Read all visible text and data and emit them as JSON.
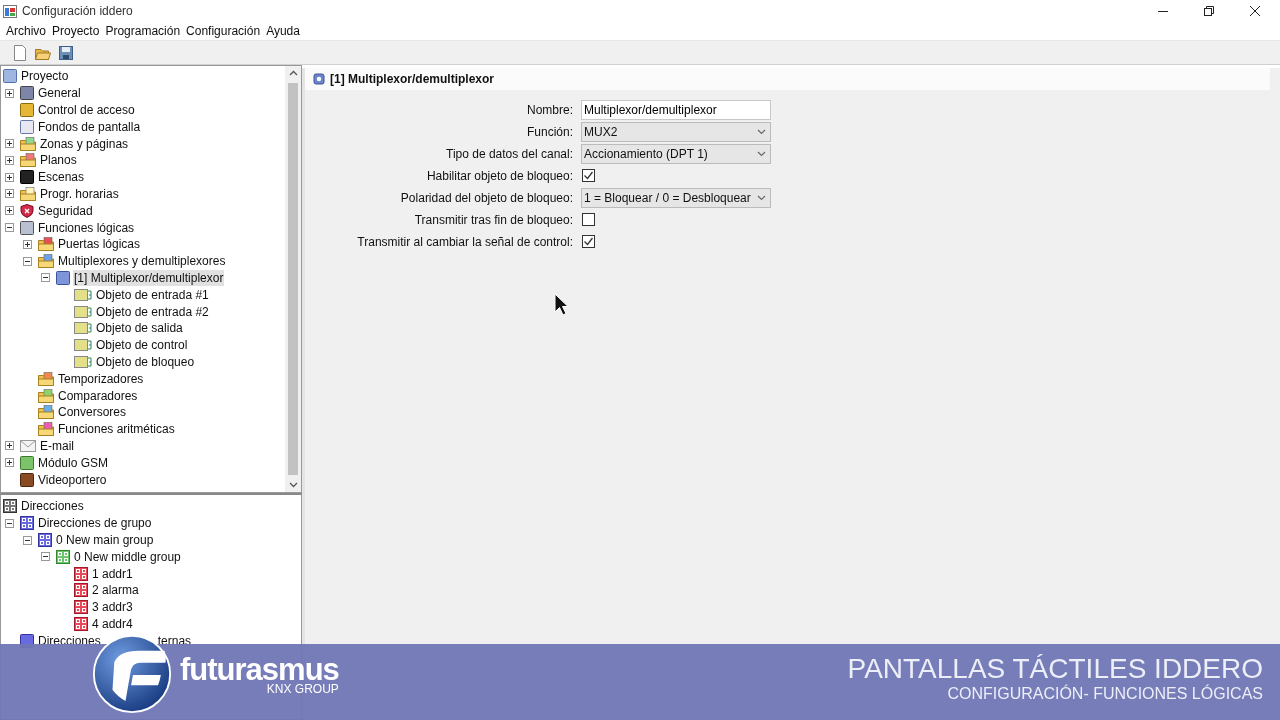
{
  "window": {
    "title": "Configuración iddero"
  },
  "menu": [
    "Archivo",
    "Proyecto",
    "Programación",
    "Configuración",
    "Ayuda"
  ],
  "project_tree": [
    {
      "label": "Proyecto",
      "selected": false,
      "children": [
        {
          "label": "General",
          "expanded": false,
          "selected": false
        },
        {
          "label": "Control de acceso",
          "selected": false
        },
        {
          "label": "Fondos de pantalla",
          "selected": false
        },
        {
          "label": "Zonas y páginas",
          "expanded": false,
          "selected": false
        },
        {
          "label": "Planos",
          "expanded": false,
          "selected": false
        },
        {
          "label": "Escenas",
          "expanded": false,
          "selected": false
        },
        {
          "label": "Progr. horarias",
          "expanded": false,
          "selected": false
        },
        {
          "label": "Seguridad",
          "expanded": false,
          "selected": false
        },
        {
          "label": "Funciones lógicas",
          "expanded": true,
          "selected": false,
          "children": [
            {
              "label": "Puertas lógicas",
              "expanded": false,
              "selected": false
            },
            {
              "label": "Multiplexores y demultiplexores",
              "expanded": true,
              "selected": false,
              "children": [
                {
                  "label": "[1] Multiplexor/demultiplexor",
                  "expanded": true,
                  "selected": true,
                  "children": [
                    {
                      "label": "Objeto de entrada #1",
                      "selected": false
                    },
                    {
                      "label": "Objeto de entrada #2",
                      "selected": false
                    },
                    {
                      "label": "Objeto de salida",
                      "selected": false
                    },
                    {
                      "label": "Objeto de control",
                      "selected": false
                    },
                    {
                      "label": "Objeto de bloqueo",
                      "selected": false
                    }
                  ]
                }
              ]
            },
            {
              "label": "Temporizadores",
              "selected": false
            },
            {
              "label": "Comparadores",
              "selected": false
            },
            {
              "label": "Conversores",
              "selected": false
            },
            {
              "label": "Funciones aritméticas",
              "selected": false
            }
          ]
        },
        {
          "label": "E-mail",
          "expanded": false,
          "selected": false
        },
        {
          "label": "Módulo GSM",
          "expanded": false,
          "selected": false
        },
        {
          "label": "Videoportero",
          "selected": false
        }
      ]
    }
  ],
  "address_tree": [
    {
      "label": "Direcciones",
      "selected": false,
      "children": [
        {
          "label": "Direcciones de grupo",
          "expanded": true,
          "selected": false,
          "children": [
            {
              "label": "0 New main group",
              "expanded": true,
              "selected": false,
              "children": [
                {
                  "label": "0 New middle group",
                  "expanded": true,
                  "selected": false,
                  "children": [
                    {
                      "label": "1 addr1",
                      "selected": false
                    },
                    {
                      "label": "2 alarma",
                      "selected": false
                    },
                    {
                      "label": "3 addr3",
                      "selected": false
                    },
                    {
                      "label": "4 addr4",
                      "selected": false
                    }
                  ]
                }
              ]
            }
          ]
        },
        {
          "label": "Direcciones",
          "label_tail": "ternas",
          "selected": false
        }
      ]
    }
  ],
  "panel": {
    "title": "[1] Multiplexor/demultiplexor",
    "fields": [
      {
        "kind": "text",
        "label": "Nombre:",
        "value": "Multiplexor/demultiplexor"
      },
      {
        "kind": "select",
        "label": "Función:",
        "value": "MUX2"
      },
      {
        "kind": "select",
        "label": "Tipo de datos del canal:",
        "value": "Accionamiento (DPT 1)"
      },
      {
        "kind": "checkbox",
        "label": "Habilitar objeto de bloqueo:",
        "checked": true
      },
      {
        "kind": "select",
        "label": "Polaridad del objeto de bloqueo:",
        "value": "1 = Bloquear / 0 = Desbloquear"
      },
      {
        "kind": "checkbox",
        "label": "Transmitir tras fin de bloqueo:",
        "checked": false
      },
      {
        "kind": "checkbox",
        "label": "Transmitir al cambiar la señal de control:",
        "checked": true
      }
    ]
  },
  "banner": {
    "brand": "futurasmus",
    "brand_sub": "KNX GROUP",
    "title": "PANTALLAS TÁCTILES IDDERO",
    "subtitle": "CONFIGURACIÓN- FUNCIONES LÓGICAS"
  }
}
